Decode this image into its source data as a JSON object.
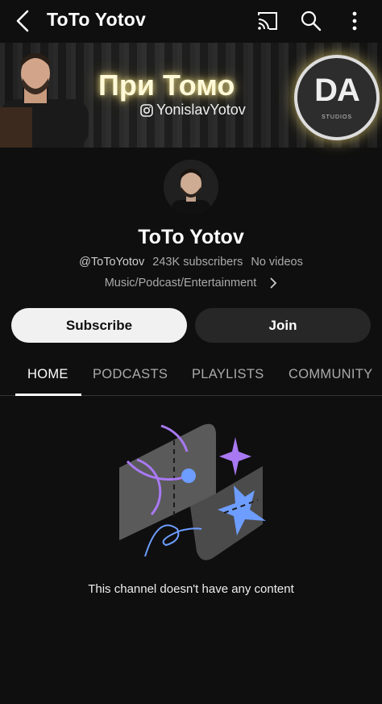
{
  "header": {
    "title": "ToTo Yotov",
    "icons": [
      "back-arrow-icon",
      "cast-icon",
      "search-icon",
      "more-vert-icon"
    ]
  },
  "banner": {
    "title": "При Томо",
    "instagram_handle": "YonislavYotov",
    "logo_text": "DA",
    "logo_subtext": "STUDIOS"
  },
  "channel": {
    "name": "ToTo Yotov",
    "handle": "@ToToYotov",
    "subscribers": "243K subscribers",
    "videos": "No videos",
    "category": "Music/Podcast/Entertainment"
  },
  "actions": {
    "subscribe_label": "Subscribe",
    "join_label": "Join"
  },
  "tabs": [
    {
      "label": "HOME",
      "active": true
    },
    {
      "label": "PODCASTS",
      "active": false
    },
    {
      "label": "PLAYLISTS",
      "active": false
    },
    {
      "label": "COMMUNITY",
      "active": false
    }
  ],
  "empty_state": {
    "message": "This channel doesn't have any content"
  },
  "colors": {
    "background": "#0f0f0f",
    "subscribe_bg": "#f1f1f1",
    "join_bg": "#272727",
    "accent_purple": "#a879f2",
    "accent_blue": "#6d9dff"
  }
}
